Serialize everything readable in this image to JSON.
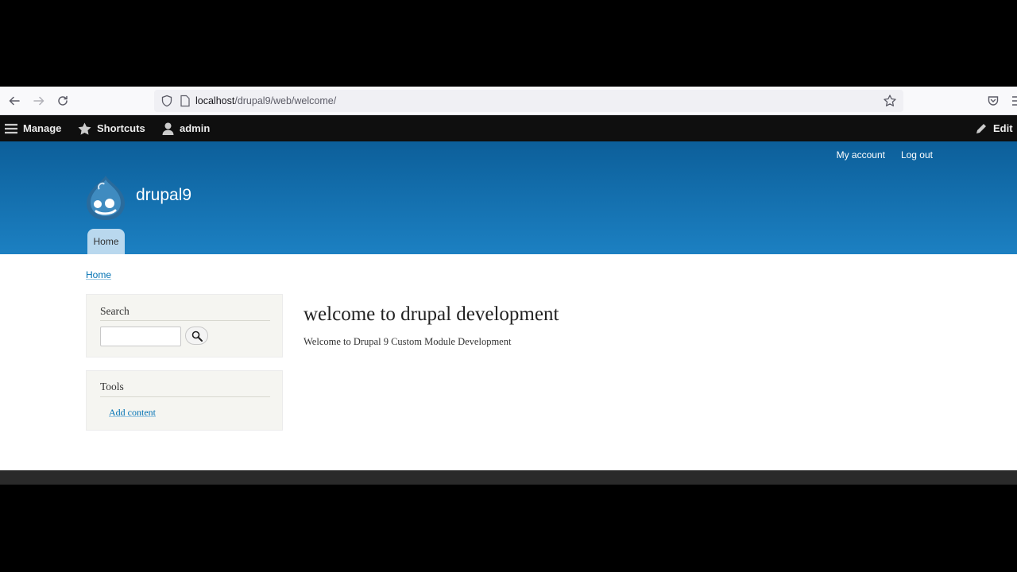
{
  "browser": {
    "url_host": "localhost",
    "url_path": "/drupal9/web/welcome/"
  },
  "toolbar": {
    "manage_label": "Manage",
    "shortcuts_label": "Shortcuts",
    "user_label": "admin",
    "edit_label": "Edit"
  },
  "header": {
    "secondary_menu": [
      "My account",
      "Log out"
    ],
    "site_name": "drupal9",
    "main_tab": "Home"
  },
  "breadcrumb": "Home",
  "sidebar": {
    "search_title": "Search",
    "search_value": "",
    "tools_title": "Tools",
    "tools_link": "Add content"
  },
  "main": {
    "title": "welcome to drupal development",
    "body": "Welcome to Drupal 9 Custom Module Development"
  },
  "colors": {
    "header_top": "#0c5f9a",
    "header_bottom": "#1c80c2",
    "link": "#0071b3",
    "toolbar": "#0f0f0f"
  }
}
